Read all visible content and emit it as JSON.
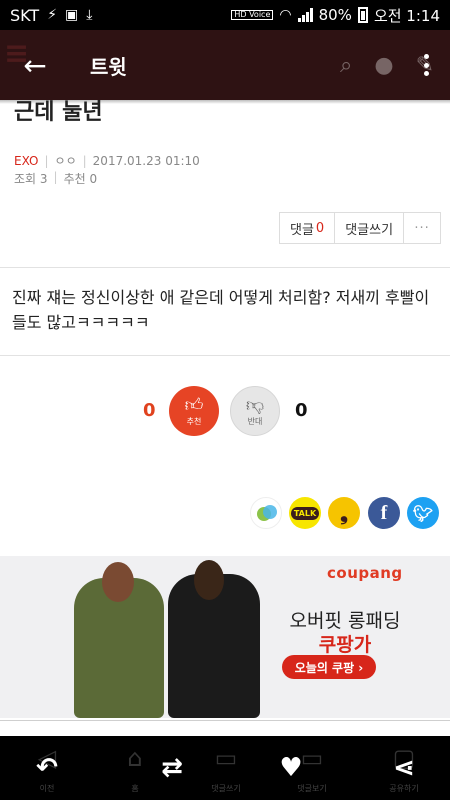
{
  "status_bar": {
    "carrier": "SKT",
    "battery_percent": "80%",
    "time": "오전 1:14",
    "hd_label": "HD Voice"
  },
  "app_bar": {
    "title": "트윗"
  },
  "post": {
    "title": "근데 눌년",
    "category": "EXO",
    "author": "ㅇㅇ",
    "datetime": "2017.01.23 01:10",
    "views_label": "조회 3",
    "recommend_label": "추천 0",
    "body": "진짜 쟤는 정신이상한 애 같은데 어떻게 처리함? 저새끼 후빨이들도 많고ㅋㅋㅋㅋㅋ"
  },
  "comment_box": {
    "comments_label": "댓글",
    "comments_count": "0",
    "write_label": "댓글쓰기",
    "more_label": "···"
  },
  "votes": {
    "up_count": "0",
    "up_label": "추천",
    "down_count": "0",
    "down_label": "반대"
  },
  "share": {
    "talk_label": "TALK",
    "facebook_glyph": "f"
  },
  "ad": {
    "brand": "coupang",
    "line1": "오버핏 롱패딩",
    "line2": "쿠팡가",
    "cta": "오늘의 쿠팡 ›"
  },
  "bottom_nav": [
    {
      "label": "이전",
      "icon": "reply-icon",
      "glyph": "↶"
    },
    {
      "label": "홈",
      "icon": "retweet-icon",
      "glyph": "⇄"
    },
    {
      "label": "댓글쓰기",
      "icon": "",
      "glyph": ""
    },
    {
      "label": "댓글보기",
      "icon": "heart-icon",
      "glyph": "♥"
    },
    {
      "label": "공유하기",
      "icon": "share-icon",
      "glyph": "⋖"
    }
  ],
  "colors": {
    "app_bar": "#2e1213",
    "accent_red": "#d7261a",
    "vote_up": "#e64425"
  }
}
